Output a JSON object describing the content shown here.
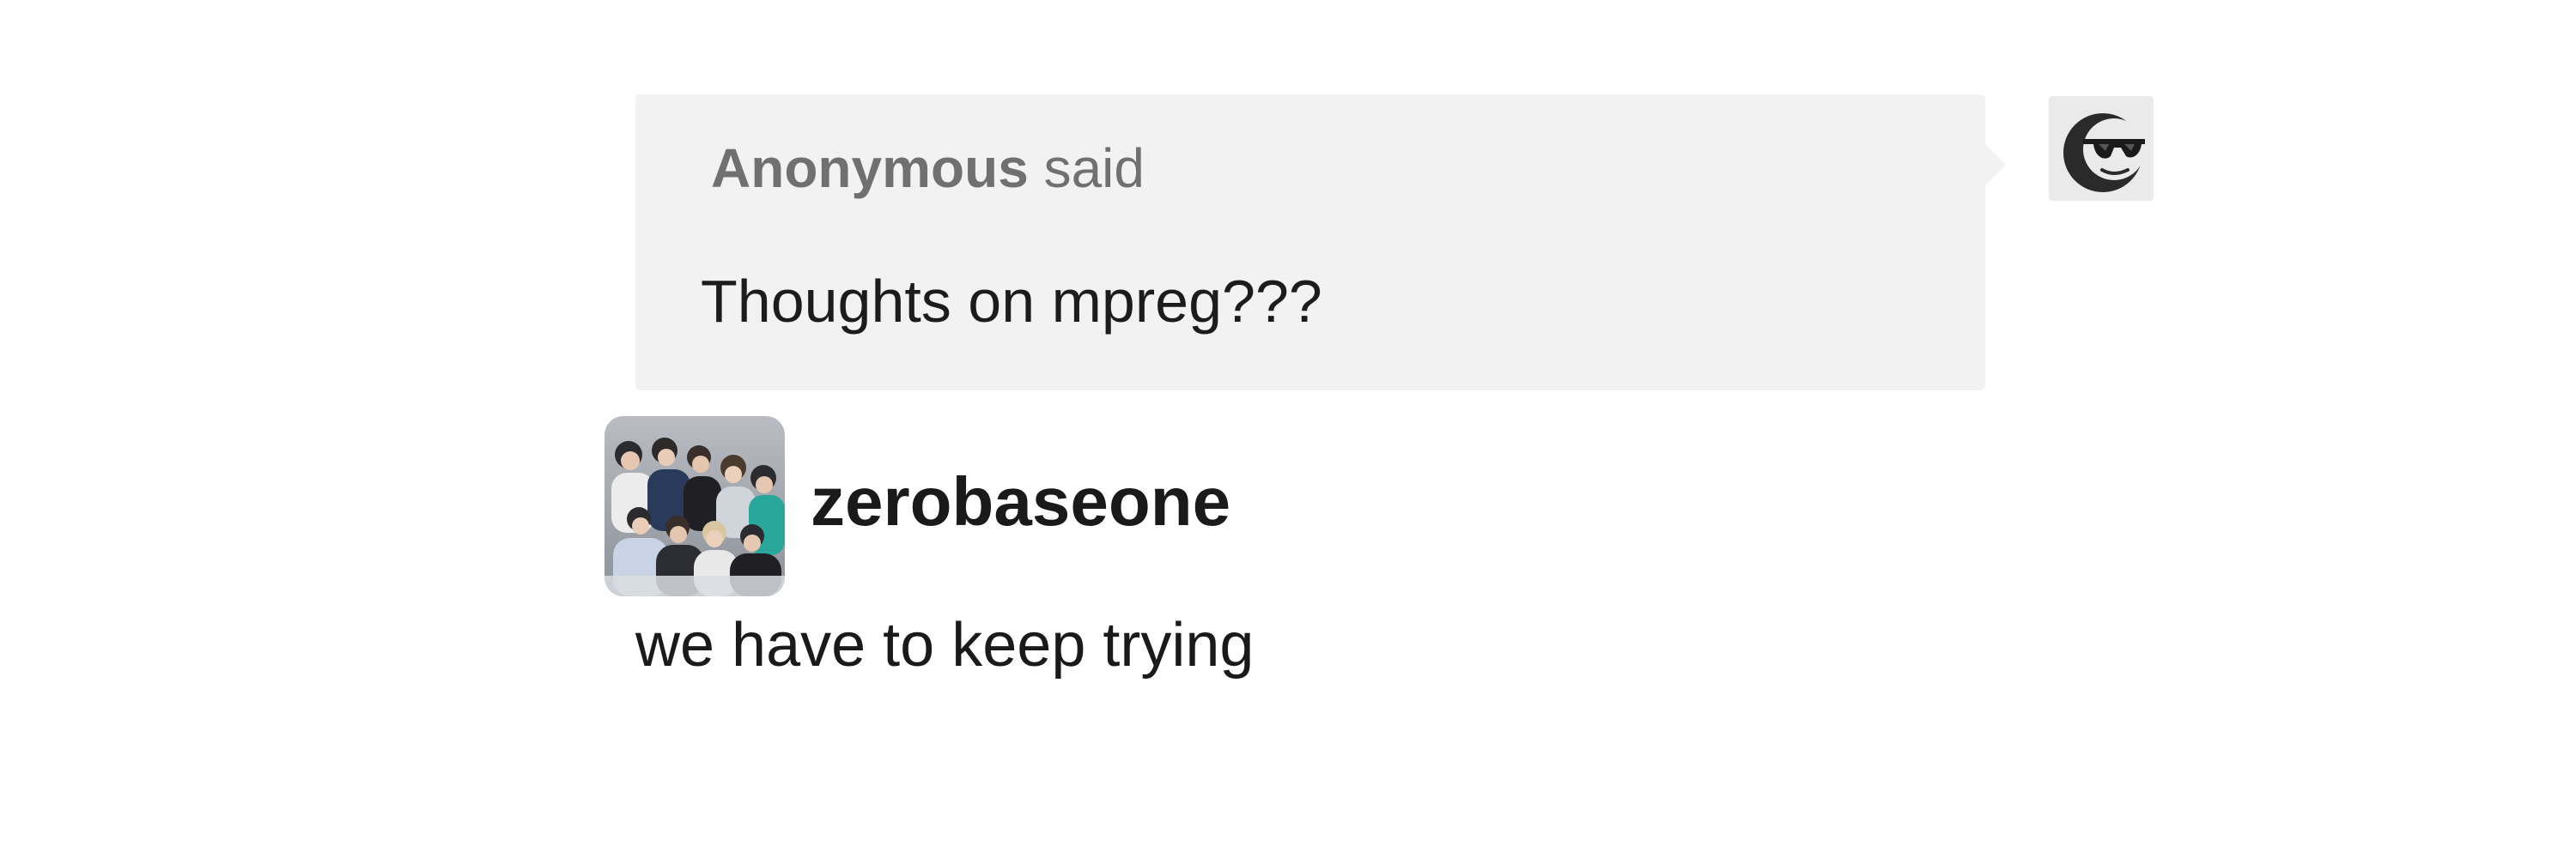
{
  "ask": {
    "asker_name": "Anonymous",
    "said_label": "said",
    "question": "Thoughts on mpreg???",
    "avatar_icon": "anonymous-sunglasses-icon"
  },
  "answer": {
    "blog_name": "zerobaseone",
    "text": "we have to keep trying",
    "avatar_icon": "group-photo-avatar"
  },
  "colors": {
    "bubble_background": "#f2f2f2",
    "asker_text": "#707070",
    "body_text": "#1a1a1a"
  }
}
